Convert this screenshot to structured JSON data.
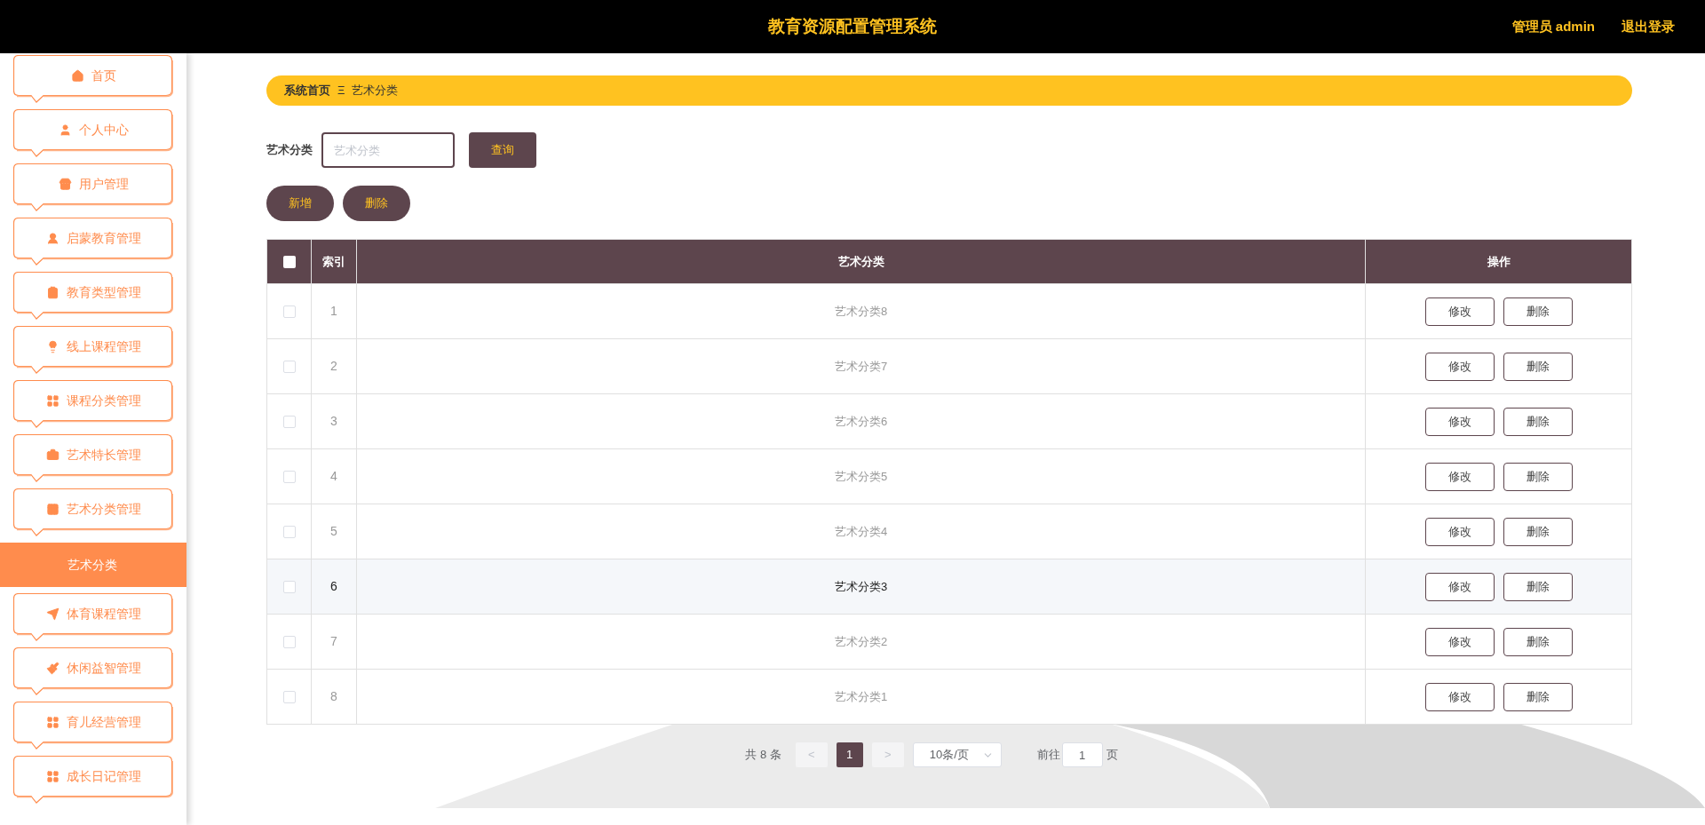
{
  "header": {
    "title": "教育资源配置管理系统",
    "user": "管理员 admin",
    "logout": "退出登录"
  },
  "sidebar": {
    "items": [
      {
        "label": "首页",
        "kind": "menu",
        "selected": false
      },
      {
        "label": "个人中心",
        "kind": "menu",
        "selected": false
      },
      {
        "label": "用户管理",
        "kind": "menu",
        "selected": false
      },
      {
        "label": "启蒙教育管理",
        "kind": "menu",
        "selected": false
      },
      {
        "label": "教育类型管理",
        "kind": "menu",
        "selected": false
      },
      {
        "label": "线上课程管理",
        "kind": "menu",
        "selected": false
      },
      {
        "label": "课程分类管理",
        "kind": "menu",
        "selected": false
      },
      {
        "label": "艺术特长管理",
        "kind": "menu",
        "selected": false
      },
      {
        "label": "艺术分类管理",
        "kind": "menu",
        "selected": false
      },
      {
        "label": "艺术分类",
        "kind": "submenu",
        "selected": true
      },
      {
        "label": "体育课程管理",
        "kind": "menu",
        "selected": false
      },
      {
        "label": "休闲益智管理",
        "kind": "menu",
        "selected": false
      },
      {
        "label": "育儿经营管理",
        "kind": "menu",
        "selected": false
      },
      {
        "label": "成长日记管理",
        "kind": "menu",
        "selected": false
      }
    ]
  },
  "breadcrumb": {
    "home": "系统首页",
    "separator": "Ξ",
    "current": "艺术分类"
  },
  "search": {
    "label": "艺术分类",
    "placeholder": "艺术分类",
    "button": "查询"
  },
  "actions": [
    "新增",
    "删除"
  ],
  "table": {
    "columns": [
      "索引",
      "艺术分类",
      "操作"
    ],
    "select_all": {
      "checked": false
    },
    "rows": [
      {
        "index": "1",
        "name": "艺术分类8",
        "checked": false,
        "highlighted": false,
        "buttons": [
          "修改",
          "删除"
        ]
      },
      {
        "index": "2",
        "name": "艺术分类7",
        "checked": false,
        "highlighted": false,
        "buttons": [
          "修改",
          "删除"
        ]
      },
      {
        "index": "3",
        "name": "艺术分类6",
        "checked": false,
        "highlighted": false,
        "buttons": [
          "修改",
          "删除"
        ]
      },
      {
        "index": "4",
        "name": "艺术分类5",
        "checked": false,
        "highlighted": false,
        "buttons": [
          "修改",
          "删除"
        ]
      },
      {
        "index": "5",
        "name": "艺术分类4",
        "checked": false,
        "highlighted": false,
        "buttons": [
          "修改",
          "删除"
        ]
      },
      {
        "index": "6",
        "name": "艺术分类3",
        "checked": false,
        "highlighted": true,
        "buttons": [
          "修改",
          "删除"
        ]
      },
      {
        "index": "7",
        "name": "艺术分类2",
        "checked": false,
        "highlighted": false,
        "buttons": [
          "修改",
          "删除"
        ]
      },
      {
        "index": "8",
        "name": "艺术分类1",
        "checked": false,
        "highlighted": false,
        "buttons": [
          "修改",
          "删除"
        ]
      }
    ]
  },
  "pagination": {
    "total": "共 8 条",
    "prev": "<",
    "pages": [
      {
        "label": "1",
        "selected": true
      }
    ],
    "next": ">",
    "page_size": "10条/页",
    "goto_label": "前往",
    "goto_value": "1",
    "goto_suffix": "页"
  }
}
